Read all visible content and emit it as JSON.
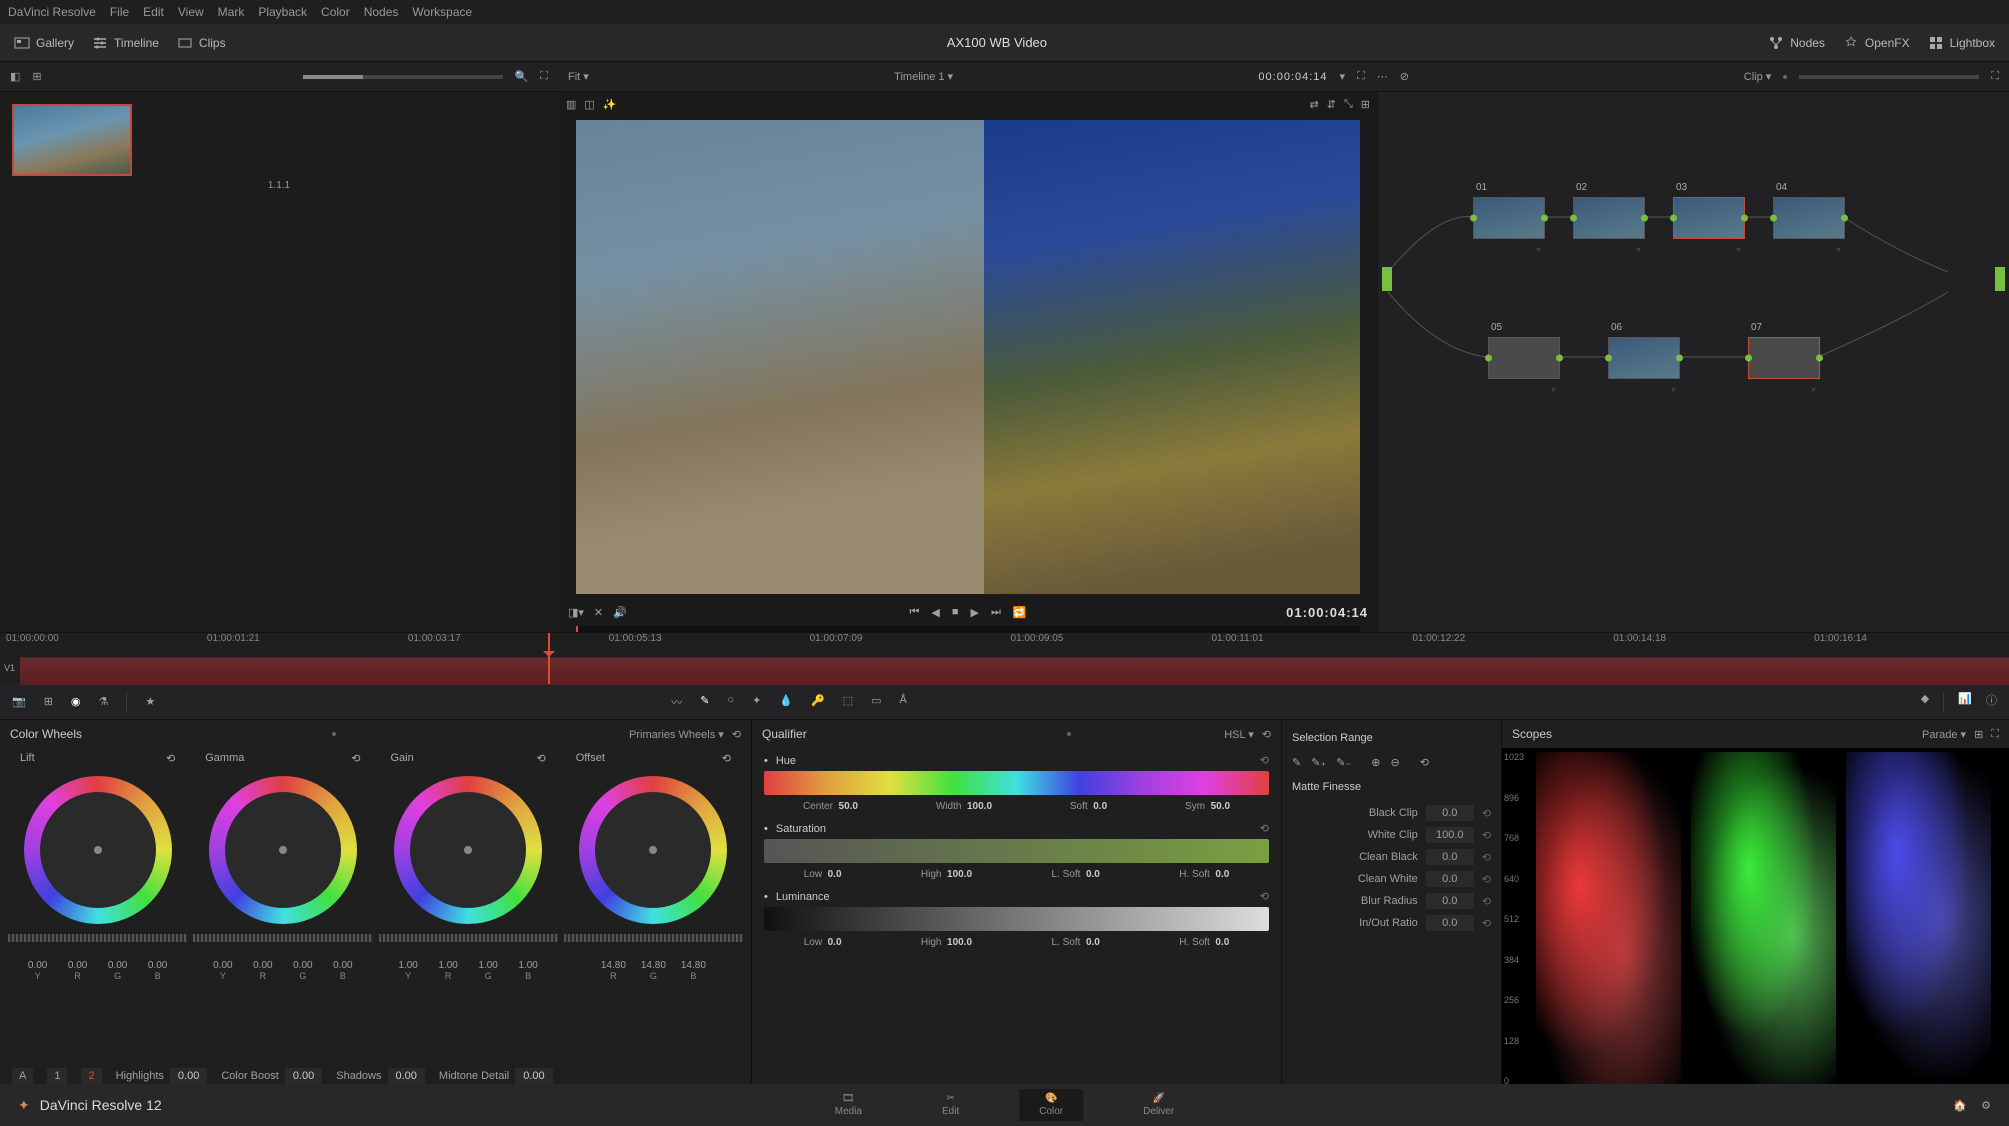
{
  "app": {
    "name": "DaVinci Resolve",
    "version_label": "DaVinci Resolve 12"
  },
  "menu": [
    "DaVinci Resolve",
    "File",
    "Edit",
    "View",
    "Mark",
    "Playback",
    "Color",
    "Nodes",
    "Workspace"
  ],
  "toolbar": {
    "gallery": "Gallery",
    "timeline": "Timeline",
    "clips": "Clips",
    "project_title": "AX100 WB Video",
    "nodes": "Nodes",
    "openfx": "OpenFX",
    "lightbox": "Lightbox"
  },
  "subbar": {
    "fit": "Fit",
    "timeline_sel": "Timeline 1",
    "timecode": "00:00:04:14",
    "clip": "Clip"
  },
  "gallery": {
    "thumb_label": "1.1.1"
  },
  "viewer": {
    "timecode": "01:00:04:14"
  },
  "node_graph": {
    "nodes": [
      {
        "id": "01"
      },
      {
        "id": "02"
      },
      {
        "id": "03"
      },
      {
        "id": "04"
      },
      {
        "id": "05"
      },
      {
        "id": "06"
      },
      {
        "id": "07"
      }
    ]
  },
  "timeline": {
    "ticks": [
      "01:00:00:00",
      "01:00:01:21",
      "01:00:03:17",
      "01:00:05:13",
      "01:00:07:09",
      "01:00:09:05",
      "01:00:11:01",
      "01:00:12:22",
      "01:00:14:18",
      "01:00:16:14"
    ],
    "track_label": "V1"
  },
  "panels": {
    "color_wheels": {
      "title": "Color Wheels",
      "mode": "Primaries Wheels",
      "wheels": [
        {
          "name": "Lift",
          "vals": [
            "0.00",
            "0.00",
            "0.00",
            "0.00"
          ],
          "ch": [
            "Y",
            "R",
            "G",
            "B"
          ]
        },
        {
          "name": "Gamma",
          "vals": [
            "0.00",
            "0.00",
            "0.00",
            "0.00"
          ],
          "ch": [
            "Y",
            "R",
            "G",
            "B"
          ]
        },
        {
          "name": "Gain",
          "vals": [
            "1.00",
            "1.00",
            "1.00",
            "1.00"
          ],
          "ch": [
            "Y",
            "R",
            "G",
            "B"
          ]
        },
        {
          "name": "Offset",
          "vals": [
            "14.80",
            "14.80",
            "14.80"
          ],
          "ch": [
            "R",
            "G",
            "B"
          ]
        }
      ],
      "page_a": "A",
      "page_1": "1",
      "page_2": "2",
      "bottom": [
        {
          "l": "Highlights",
          "v": "0.00"
        },
        {
          "l": "Color Boost",
          "v": "0.00"
        },
        {
          "l": "Shadows",
          "v": "0.00"
        },
        {
          "l": "Midtone Detail",
          "v": "0.00"
        }
      ]
    },
    "qualifier": {
      "title": "Qualifier",
      "mode": "HSL",
      "hue": {
        "label": "Hue",
        "params": [
          [
            "Center",
            "50.0"
          ],
          [
            "Width",
            "100.0"
          ],
          [
            "Soft",
            "0.0"
          ],
          [
            "Sym",
            "50.0"
          ]
        ]
      },
      "sat": {
        "label": "Saturation",
        "params": [
          [
            "Low",
            "0.0"
          ],
          [
            "High",
            "100.0"
          ],
          [
            "L. Soft",
            "0.0"
          ],
          [
            "H. Soft",
            "0.0"
          ]
        ]
      },
      "lum": {
        "label": "Luminance",
        "params": [
          [
            "Low",
            "0.0"
          ],
          [
            "High",
            "100.0"
          ],
          [
            "L. Soft",
            "0.0"
          ],
          [
            "H. Soft",
            "0.0"
          ]
        ]
      }
    },
    "matte": {
      "sel_range": "Selection Range",
      "finesse": "Matte Finesse",
      "rows": [
        {
          "l": "Black Clip",
          "v": "0.0"
        },
        {
          "l": "White Clip",
          "v": "100.0"
        },
        {
          "l": "Clean Black",
          "v": "0.0"
        },
        {
          "l": "Clean White",
          "v": "0.0"
        },
        {
          "l": "Blur Radius",
          "v": "0.0"
        },
        {
          "l": "In/Out Ratio",
          "v": "0.0"
        }
      ]
    },
    "scopes": {
      "title": "Scopes",
      "mode": "Parade",
      "scale": [
        "1023",
        "896",
        "768",
        "640",
        "512",
        "384",
        "256",
        "128",
        "0"
      ]
    }
  },
  "bottombar": {
    "pages": [
      "Media",
      "Edit",
      "Color",
      "Deliver"
    ]
  }
}
